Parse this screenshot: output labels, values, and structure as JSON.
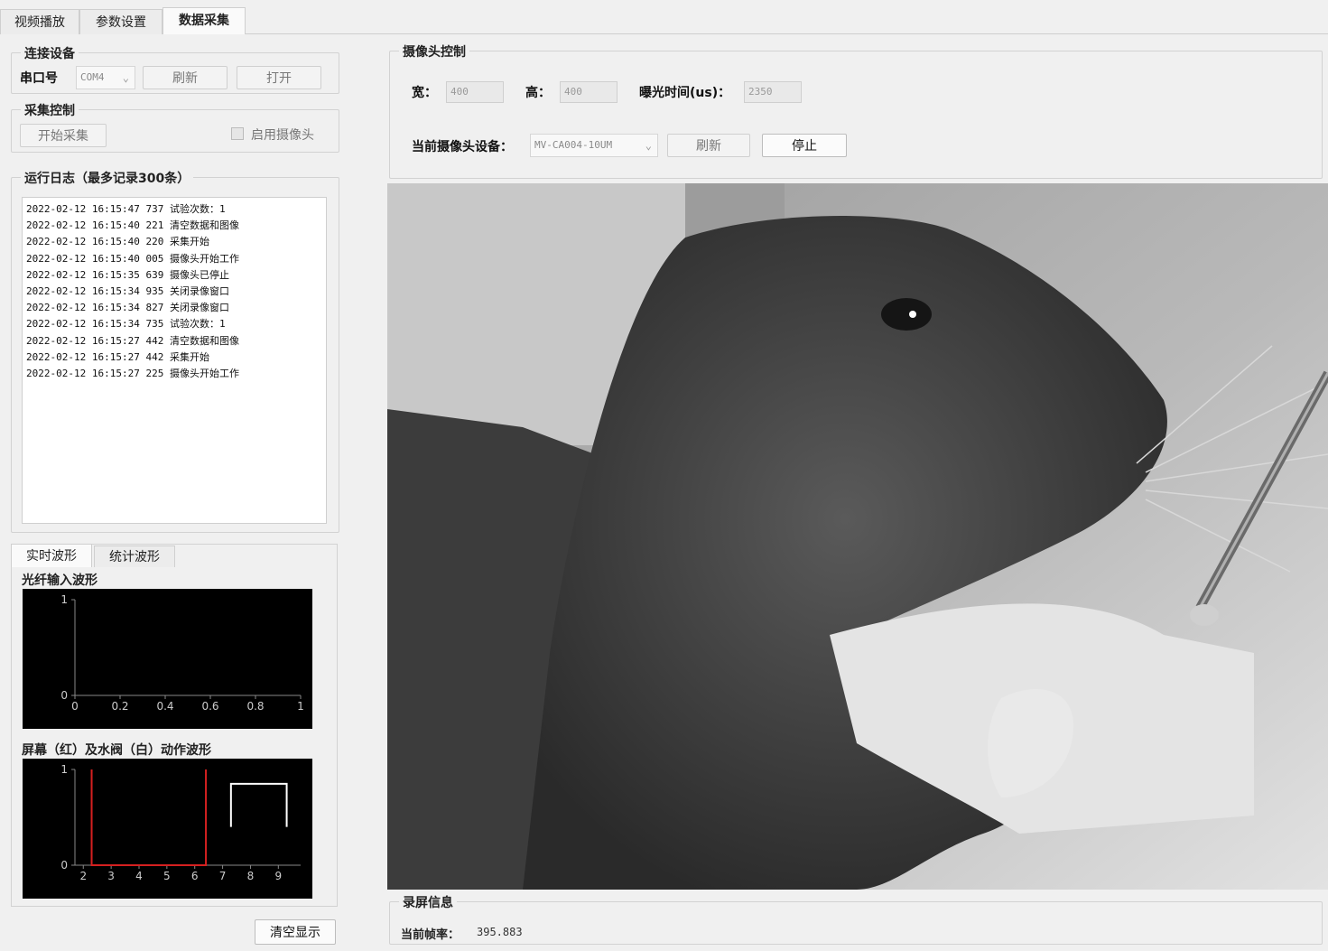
{
  "tabs": [
    "视频播放",
    "参数设置",
    "数据采集"
  ],
  "connect": {
    "legend": "连接设备",
    "port_label": "串口号",
    "port_value": "COM4",
    "refresh": "刷新",
    "open": "打开"
  },
  "acquisition": {
    "legend": "采集控制",
    "start": "开始采集",
    "enable_camera": "启用摄像头"
  },
  "log": {
    "legend": "运行日志（最多记录300条）",
    "lines": [
      "2022-02-12 16:15:47 737 试验次数：1",
      "2022-02-12 16:15:40 221 清空数据和图像",
      "2022-02-12 16:15:40 220 采集开始",
      "2022-02-12 16:15:40 005 摄像头开始工作",
      "2022-02-12 16:15:35 639 摄像头已停止",
      "2022-02-12 16:15:34 935 关闭录像窗口",
      "2022-02-12 16:15:34 827 关闭录像窗口",
      "2022-02-12 16:15:34 735 试验次数：1",
      "2022-02-12 16:15:27 442 清空数据和图像",
      "2022-02-12 16:15:27 442 采集开始",
      "2022-02-12 16:15:27 225 摄像头开始工作"
    ]
  },
  "wave_tabs": [
    "实时波形",
    "统计波形"
  ],
  "fiber_plot": {
    "title": "光纤输入波形",
    "chart_data": {
      "type": "line",
      "x_ticks": [
        "0",
        "0.2",
        "0.4",
        "0.6",
        "0.8",
        "1"
      ],
      "y_ticks": [
        "0",
        "1"
      ],
      "xlim": [
        0,
        1
      ],
      "ylim": [
        0,
        1
      ],
      "series": []
    }
  },
  "action_plot": {
    "title": "屏幕（红）及水阀（白）动作波形",
    "chart_data": {
      "type": "line",
      "x_ticks": [
        "2",
        "3",
        "4",
        "5",
        "6",
        "7",
        "8",
        "9"
      ],
      "y_ticks": [
        "0",
        "1"
      ],
      "xlim": [
        1.7,
        9.8
      ],
      "ylim": [
        0,
        1
      ],
      "series": [
        {
          "color": "#d62020",
          "x": [
            2.3,
            2.3,
            6.4,
            6.4
          ],
          "y": [
            1,
            0,
            0,
            1
          ]
        },
        {
          "color": "#ffffff",
          "x": [
            7.3,
            7.3,
            9.3,
            9.3
          ],
          "y": [
            0.4,
            0.85,
            0.85,
            0.4
          ]
        }
      ]
    }
  },
  "clear_display": "清空显示",
  "camera": {
    "legend": "摄像头控制",
    "width_label": "宽：",
    "width_value": "400",
    "height_label": "高：",
    "height_value": "400",
    "exposure_label": "曝光时间(us)：",
    "exposure_value": "2350",
    "device_label": "当前摄像头设备：",
    "device_value": "MV-CA004-10UM",
    "refresh": "刷新",
    "stop": "停止"
  },
  "record": {
    "legend": "录屏信息",
    "fps_label": "当前帧率：",
    "fps_value": "395.883"
  },
  "colors": {
    "screen": "#d62020",
    "valve": "#ffffff"
  },
  "icons": [
    "chevron-down-icon",
    "checkbox-icon"
  ]
}
